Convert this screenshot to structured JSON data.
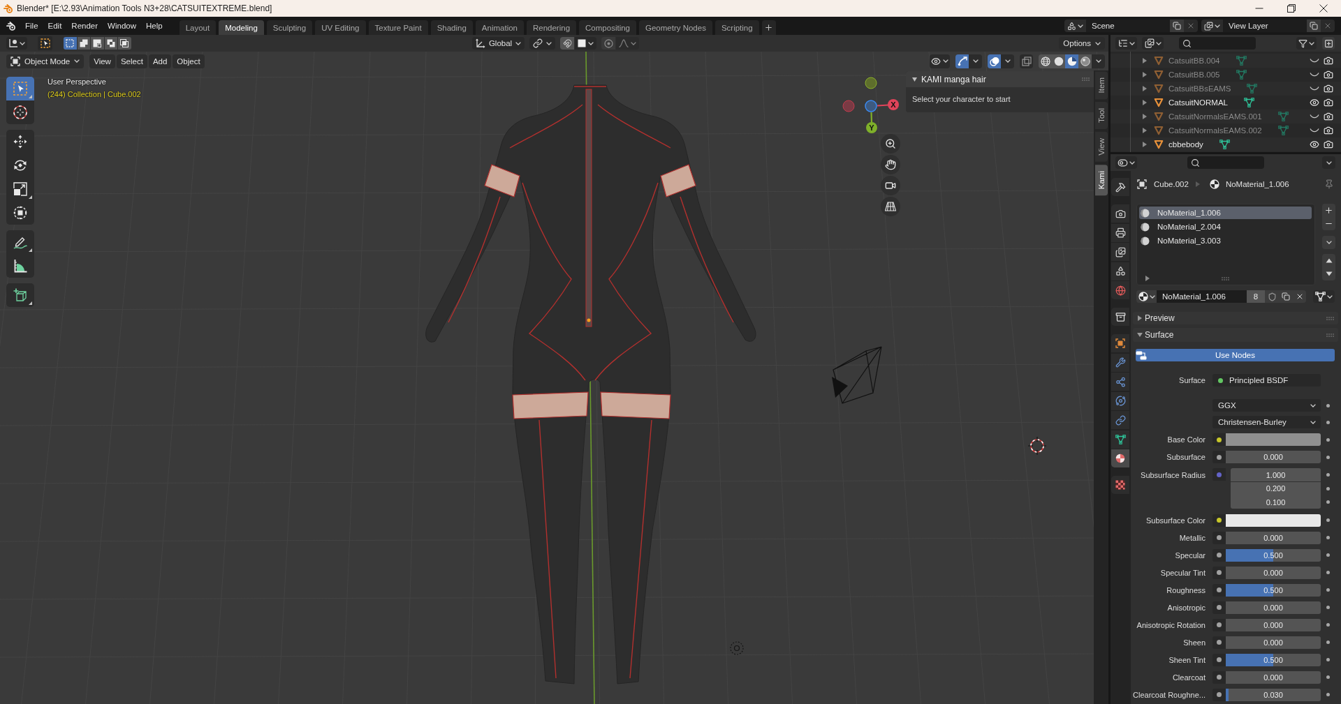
{
  "window": {
    "title": "Blender* [E:\\2.93\\Animation Tools N3+28\\CATSUITEXTREME.blend]"
  },
  "menu": [
    "File",
    "Edit",
    "Render",
    "Window",
    "Help"
  ],
  "workspaces": [
    {
      "label": "Layout",
      "selected": false
    },
    {
      "label": "Modeling",
      "selected": true
    },
    {
      "label": "Sculpting",
      "selected": false
    },
    {
      "label": "UV Editing",
      "selected": false
    },
    {
      "label": "Texture Paint",
      "selected": false
    },
    {
      "label": "Shading",
      "selected": false
    },
    {
      "label": "Animation",
      "selected": false
    },
    {
      "label": "Rendering",
      "selected": false
    },
    {
      "label": "Compositing",
      "selected": false
    },
    {
      "label": "Geometry Nodes",
      "selected": false
    },
    {
      "label": "Scripting",
      "selected": false
    }
  ],
  "scene": "Scene",
  "view_layer": "View Layer",
  "tool_header": {
    "select_modes": [
      {
        "kind": "set",
        "selected": true
      },
      {
        "kind": "extend",
        "selected": false
      },
      {
        "kind": "subtract",
        "selected": false
      },
      {
        "kind": "invert",
        "selected": false
      },
      {
        "kind": "intersect",
        "selected": false
      }
    ],
    "orientation": "Global",
    "snap": false,
    "proportional": false,
    "options": "Options"
  },
  "viewport_header": {
    "mode": "Object Mode",
    "menus": [
      "View",
      "Select",
      "Add",
      "Object"
    ],
    "toggles": [
      {
        "kind": "gizmos",
        "on": true
      },
      {
        "kind": "overlays",
        "on": true
      },
      {
        "kind": "xray",
        "on": false
      }
    ],
    "shading": [
      {
        "kind": "wireframe",
        "selected": false
      },
      {
        "kind": "solid",
        "selected": false
      },
      {
        "kind": "material",
        "selected": true
      },
      {
        "kind": "rendered",
        "selected": false
      }
    ]
  },
  "toolbar": {
    "groups": [
      {
        "tools": [
          {
            "kind": "select_box",
            "selected": true
          },
          {
            "kind": "cursor",
            "selected": false
          }
        ]
      },
      {
        "tools": [
          {
            "kind": "move",
            "selected": false
          },
          {
            "kind": "rotate",
            "selected": false
          },
          {
            "kind": "scale",
            "selected": false
          },
          {
            "kind": "transform",
            "selected": false
          }
        ]
      },
      {
        "tools": [
          {
            "kind": "annotate",
            "selected": false
          },
          {
            "kind": "measure",
            "selected": false
          }
        ]
      },
      {
        "tools": [
          {
            "kind": "add_cube",
            "selected": false
          }
        ]
      }
    ]
  },
  "viewport": {
    "view": "User Perspective",
    "context": "(244) Collection | Cube.002",
    "gizmo": {
      "x": "X",
      "y": "Y"
    }
  },
  "sidebar": {
    "panel": {
      "title": "KAMI manga hair",
      "expanded": true,
      "message": "Select your character to start"
    },
    "tabs": [
      {
        "label": "Item",
        "selected": false
      },
      {
        "label": "Tool",
        "selected": false
      },
      {
        "label": "View",
        "selected": false
      },
      {
        "label": "Kami",
        "selected": true
      }
    ]
  },
  "outliner": {
    "rows": [
      {
        "name": "CatsuitBB.004",
        "visible": false,
        "expanded": false
      },
      {
        "name": "CatsuitBB.005",
        "visible": false,
        "expanded": false
      },
      {
        "name": "CatsuitBBsEAMS",
        "visible": false,
        "expanded": false
      },
      {
        "name": "CatsuitNORMAL",
        "visible": true,
        "expanded": false
      },
      {
        "name": "CatsuitNormalsEAMS.001",
        "visible": false,
        "expanded": false
      },
      {
        "name": "CatsuitNormalsEAMS.002",
        "visible": false,
        "expanded": false
      },
      {
        "name": "cbbebody",
        "visible": true,
        "expanded": false
      }
    ]
  },
  "properties": {
    "tab_groups": [
      [
        {
          "kind": "tool",
          "selected": false
        }
      ],
      [
        {
          "kind": "render",
          "selected": false
        },
        {
          "kind": "output",
          "selected": false
        },
        {
          "kind": "view_layer",
          "selected": false
        },
        {
          "kind": "scene",
          "selected": false
        },
        {
          "kind": "world",
          "selected": false
        }
      ],
      [
        {
          "kind": "collection",
          "selected": false
        }
      ],
      [
        {
          "kind": "object",
          "selected": false
        },
        {
          "kind": "modifiers",
          "selected": false
        },
        {
          "kind": "particles",
          "selected": false
        },
        {
          "kind": "physics",
          "selected": false
        },
        {
          "kind": "constraints",
          "selected": false
        },
        {
          "kind": "data",
          "selected": false
        },
        {
          "kind": "material",
          "selected": true
        }
      ],
      [
        {
          "kind": "texture",
          "selected": false
        }
      ]
    ],
    "breadcrumb": {
      "object": "Cube.002",
      "material": "NoMaterial_1.006"
    },
    "slots": [
      {
        "name": "NoMaterial_1.006",
        "selected": true
      },
      {
        "name": "NoMaterial_2.004",
        "selected": false
      },
      {
        "name": "NoMaterial_3.003",
        "selected": false
      }
    ],
    "material": {
      "name": "NoMaterial_1.006",
      "users": "8"
    },
    "preview": {
      "title": "Preview",
      "expanded": false
    },
    "surface_panel": {
      "title": "Surface",
      "expanded": true
    },
    "use_nodes": {
      "label": "Use Nodes",
      "on": true
    },
    "surface": {
      "label": "Surface",
      "shader": "Principled BSDF"
    },
    "methods": [
      "GGX",
      "Christensen-Burley"
    ],
    "inputs": [
      {
        "kind": "color",
        "label": "Base Color",
        "color": "#909090"
      },
      {
        "kind": "value",
        "label": "Subsurface",
        "value": "0.000"
      },
      {
        "kind": "vector",
        "label": "Subsurface Radius",
        "values": [
          "1.000",
          "0.200",
          "0.100"
        ]
      },
      {
        "kind": "color",
        "label": "Subsurface Color",
        "color": "#e8e8e8"
      },
      {
        "kind": "value",
        "label": "Metallic",
        "value": "0.000"
      },
      {
        "kind": "value",
        "label": "Specular",
        "value": "0.500",
        "level": 0.5
      },
      {
        "kind": "value",
        "label": "Specular Tint",
        "value": "0.000"
      },
      {
        "kind": "value",
        "label": "Roughness",
        "value": "0.500",
        "level": 0.5
      },
      {
        "kind": "value",
        "label": "Anisotropic",
        "value": "0.000"
      },
      {
        "kind": "value",
        "label": "Anisotropic Rotation",
        "value": "0.000"
      },
      {
        "kind": "value",
        "label": "Sheen",
        "value": "0.000"
      },
      {
        "kind": "value",
        "label": "Sheen Tint",
        "value": "0.500",
        "level": 0.5
      },
      {
        "kind": "value",
        "label": "Clearcoat",
        "value": "0.000"
      },
      {
        "kind": "value",
        "label": "Clearcoat Roughne...",
        "value": "0.030",
        "level": 0.03
      }
    ]
  }
}
